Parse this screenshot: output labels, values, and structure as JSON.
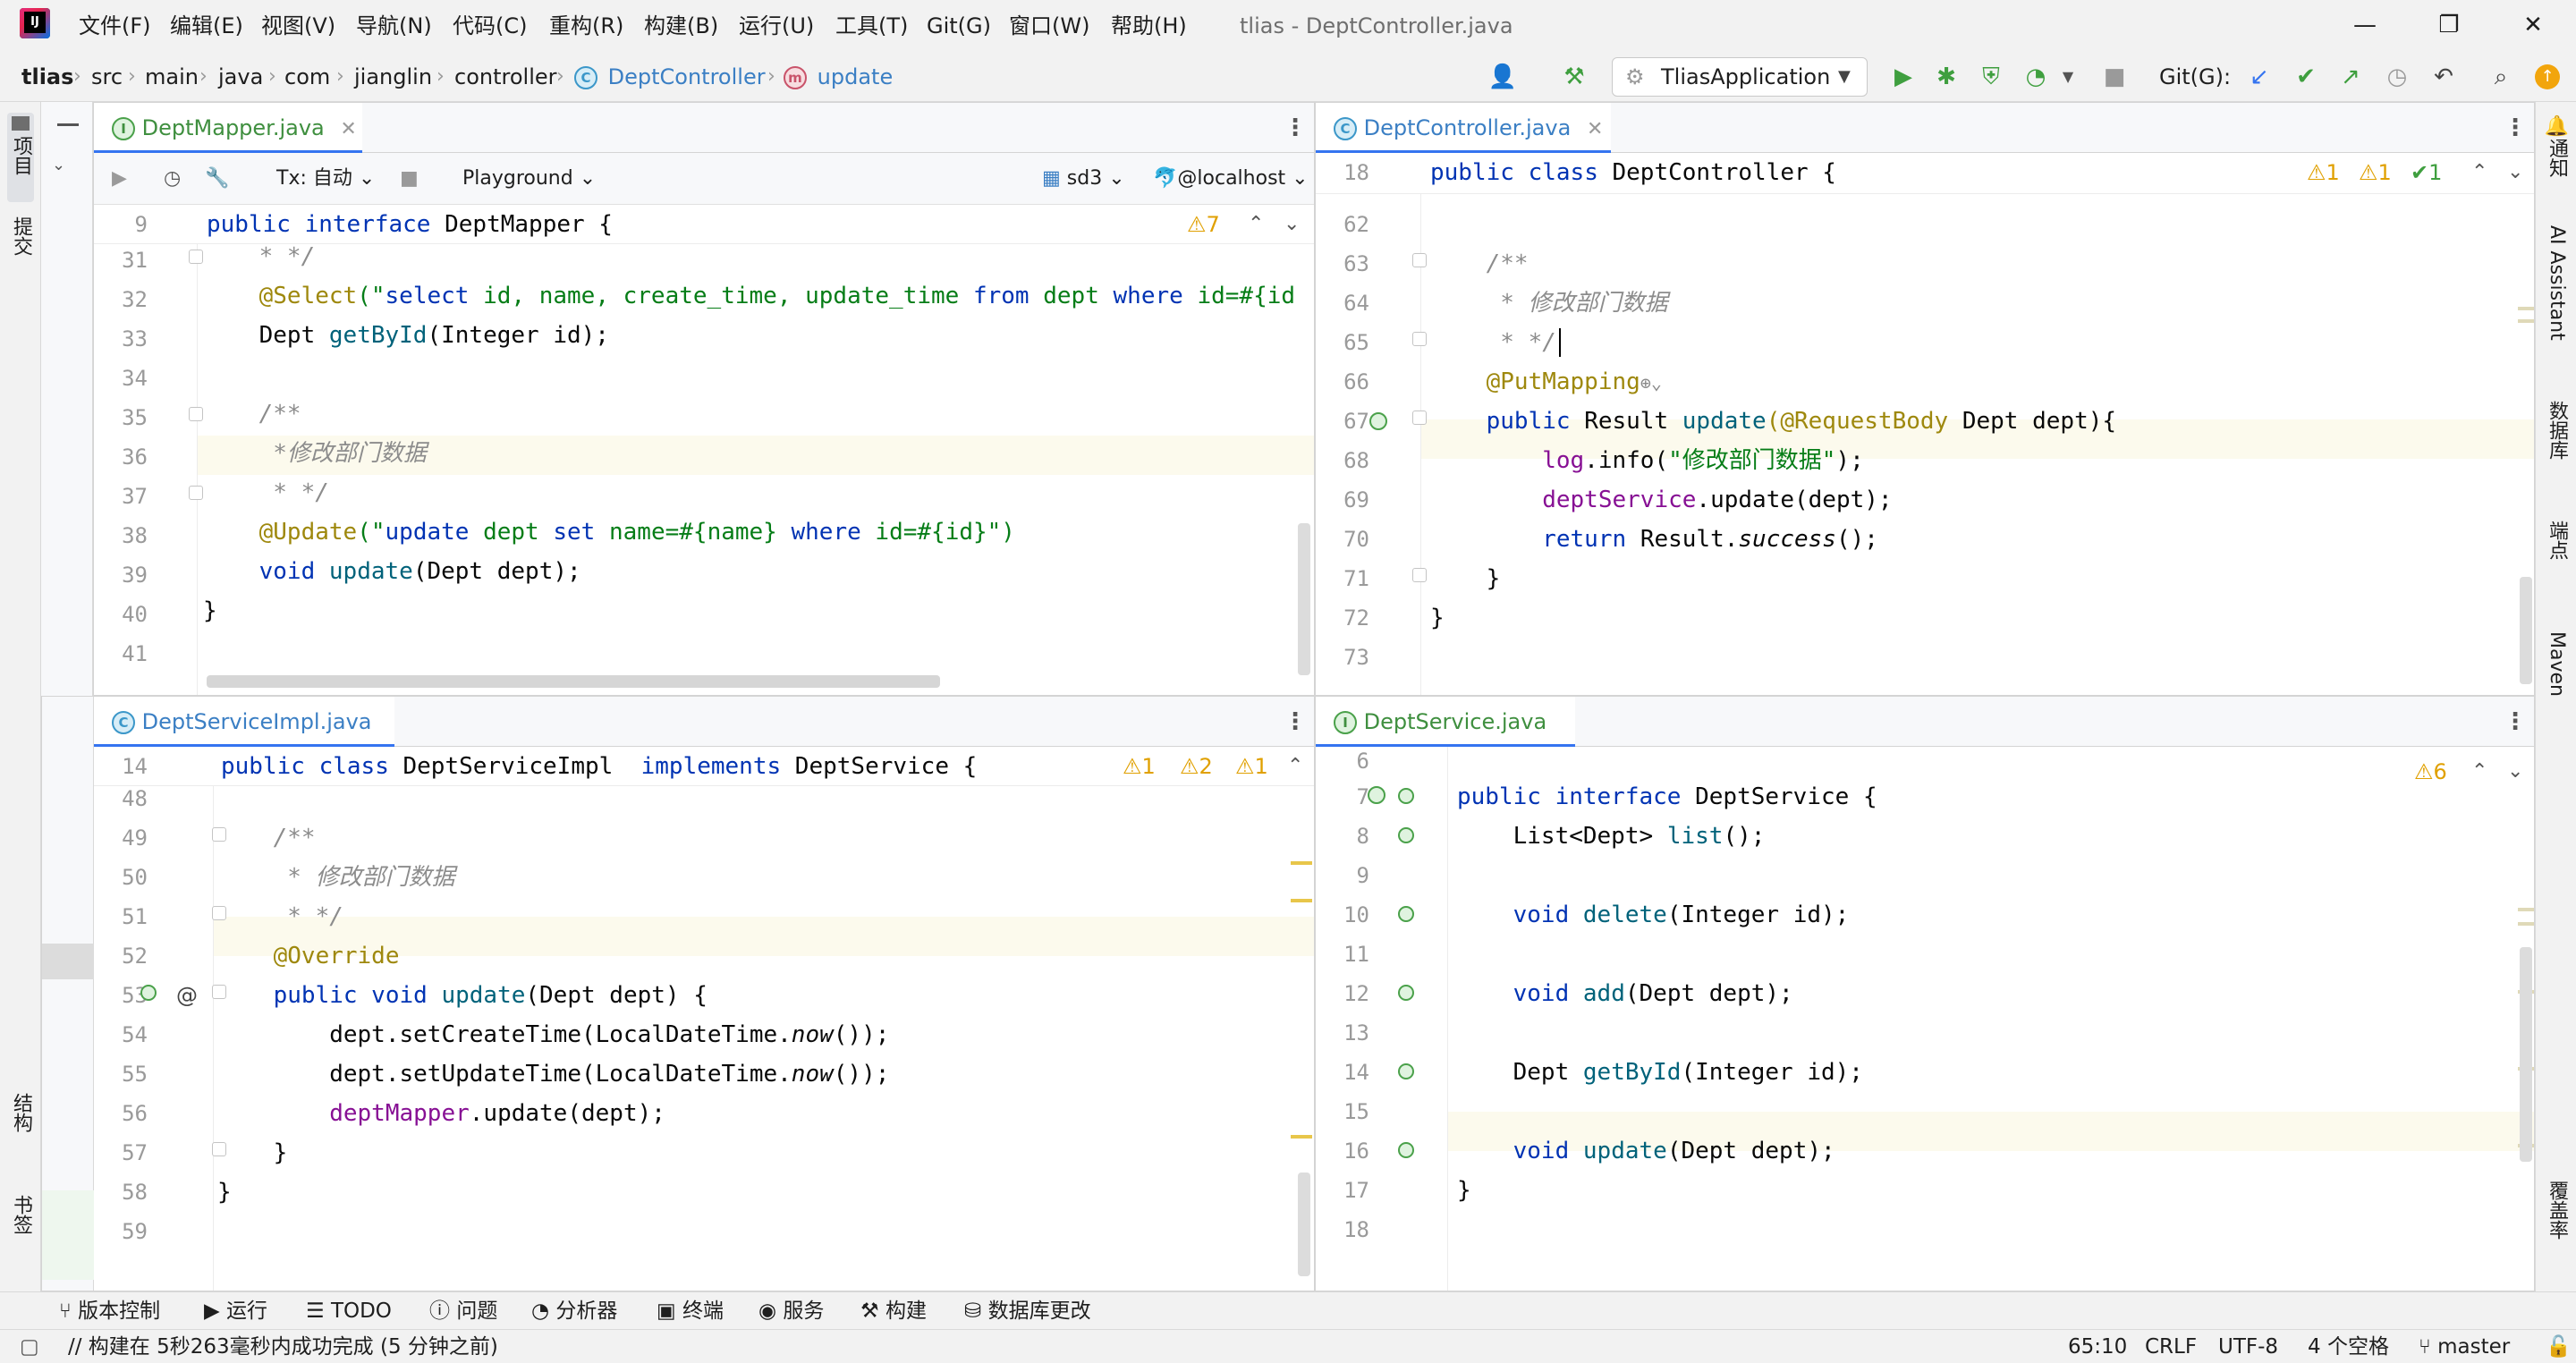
{
  "titlebar": {
    "menus": [
      "文件(F)",
      "编辑(E)",
      "视图(V)",
      "导航(N)",
      "代码(C)",
      "重构(R)",
      "构建(B)",
      "运行(U)",
      "工具(T)",
      "Git(G)",
      "窗口(W)",
      "帮助(H)"
    ],
    "window_title": "tlias - DeptController.java",
    "minimize": "—",
    "restore": "❐",
    "close": "✕"
  },
  "breadcrumb": {
    "project": "tlias",
    "items": [
      "src",
      "main",
      "java",
      "com",
      "jianglin",
      "controller"
    ],
    "class_name": "DeptController",
    "method_name": "update",
    "sep": "›",
    "class_icon": "C",
    "method_icon": "m"
  },
  "toolbar": {
    "run_config": "TliasApplication",
    "git_label": "Git(G):"
  },
  "left_strip": {
    "project": "项目",
    "commit": "提交",
    "structure": "结构",
    "bookmarks": "书签"
  },
  "right_strip": {
    "notifications": "通知",
    "ai": "AI Assistant",
    "database": "数据库",
    "endpoints": "端点",
    "maven": "Maven",
    "coverage": "覆盖率"
  },
  "pane_tl": {
    "tab": "DeptMapper.java",
    "tab_icon": "I",
    "db": {
      "tx": "Tx: 自动",
      "playground": "Playground",
      "schema": "sd3",
      "host": "@localhost"
    },
    "sticky_line": "9",
    "sticky_code": [
      "public ",
      "interface ",
      "DeptMapper {"
    ],
    "warnings": "⚠7",
    "lines": [
      "31",
      "32",
      "33",
      "34",
      "35",
      "36",
      "37",
      "38",
      "39",
      "40",
      "41"
    ],
    "code": {
      "l31": "    * */",
      "l32_a": "    ",
      "l32_an": "@Select",
      "l32_s1": "(\"",
      "l32_kw1": "select ",
      "l32_t1": "id, name, create_time, update_time ",
      "l32_kw2": "from ",
      "l32_t2": "dept ",
      "l32_kw3": "where ",
      "l32_t3": "id=#{id",
      "l33_a": "    Dept ",
      "l33_fn": "getById",
      "l33_b": "(Integer id);",
      "l35": "    /**",
      "l36": "     *修改部门数据",
      "l37": "     * */",
      "l38_a": "    ",
      "l38_an": "@Update",
      "l38_s1": "(\"",
      "l38_kw1": "update ",
      "l38_t1": "dept ",
      "l38_kw2": "set ",
      "l38_t2": "name=#{name} ",
      "l38_kw3": "where ",
      "l38_t3": "id=#{id}",
      "l38_end": "\")",
      "l39_kw": "    void ",
      "l39_fn": "update",
      "l39_b": "(Dept dept);",
      "l40": "}"
    }
  },
  "pane_tr": {
    "tab": "DeptController.java",
    "tab_icon": "C",
    "sticky_line": "18",
    "sticky_code": [
      "public ",
      "class ",
      "DeptController {"
    ],
    "warn1": "⚠1",
    "warn2": "⚠1",
    "ok1": "✔1",
    "lines": [
      "62",
      "63",
      "64",
      "65",
      "66",
      "67",
      "68",
      "69",
      "70",
      "71",
      "72",
      "73"
    ],
    "code": {
      "l63": "    /**",
      "l64": "     * 修改部门数据",
      "l65": "     * */",
      "l66_an": "    @PutMapping",
      "l67_kw": "    public ",
      "l67_t1": "Result ",
      "l67_fn": "update",
      "l67_an": "(@RequestBody ",
      "l67_t2": "Dept dept){",
      "l68_fld": "        log",
      "l68_t1": ".info(",
      "l68_str": "\"修改部门数据\"",
      "l68_t2": ");",
      "l69_fld": "        deptService",
      "l69_t1": ".update(dept);",
      "l70_kw": "        return ",
      "l70_t1": "Result.",
      "l70_it": "success",
      "l70_t2": "();",
      "l71": "    }",
      "l72": "}"
    }
  },
  "pane_bl": {
    "tab": "DeptServiceImpl.java",
    "tab_icon": "C",
    "sticky_line": "14",
    "sticky_code": [
      "public ",
      "class ",
      "DeptServiceImpl  ",
      "implements ",
      "DeptService {"
    ],
    "warn1": "⚠1",
    "warn2": "⚠2",
    "warn3": "⚠1",
    "lines": [
      "48",
      "49",
      "50",
      "51",
      "52",
      "53",
      "54",
      "55",
      "56",
      "57",
      "58",
      "59"
    ],
    "code": {
      "l49": "    /**",
      "l50": "     * 修改部门数据",
      "l51": "     * */",
      "l52": "    @Override",
      "l53_kw": "    public void ",
      "l53_fn": "update",
      "l53_t": "(Dept dept) {",
      "l54_t1": "        dept.setCreateTime(LocalDateTime.",
      "l54_it": "now",
      "l54_t2": "());",
      "l55_t1": "        dept.setUpdateTime(LocalDateTime.",
      "l55_it": "now",
      "l55_t2": "());",
      "l56_fld": "        deptMapper",
      "l56_t": ".update(dept);",
      "l57": "    }",
      "l58": "}"
    }
  },
  "pane_br": {
    "tab": "DeptService.java",
    "tab_icon": "I",
    "warn": "⚠6",
    "lines": [
      "6",
      "7",
      "8",
      "9",
      "10",
      "11",
      "12",
      "13",
      "14",
      "15",
      "16",
      "17",
      "18"
    ],
    "code": {
      "l7_kw": "public interface ",
      "l7_t": "DeptService {",
      "l8_t": "    List<Dept> ",
      "l8_fn": "list",
      "l8_e": "();",
      "l10_kw": "    void ",
      "l10_fn": "delete",
      "l10_e": "(Integer id);",
      "l12_kw": "    void ",
      "l12_fn": "add",
      "l12_e": "(Dept dept);",
      "l14_t": "    Dept ",
      "l14_fn": "getById",
      "l14_e": "(Integer id);",
      "l16_kw": "    void ",
      "l16_fn": "update",
      "l16_e": "(Dept dept);",
      "l17": "}"
    }
  },
  "bottom_tools": [
    "版本控制",
    "运行",
    "TODO",
    "问题",
    "分析器",
    "终端",
    "服务",
    "构建",
    "数据库更改"
  ],
  "status": {
    "message": "// 构建在 5秒263毫秒内成功完成 (5 分钟之前)",
    "position": "65:10",
    "line_sep": "CRLF",
    "encoding": "UTF-8",
    "indent": "4 个空格",
    "branch": "master"
  }
}
